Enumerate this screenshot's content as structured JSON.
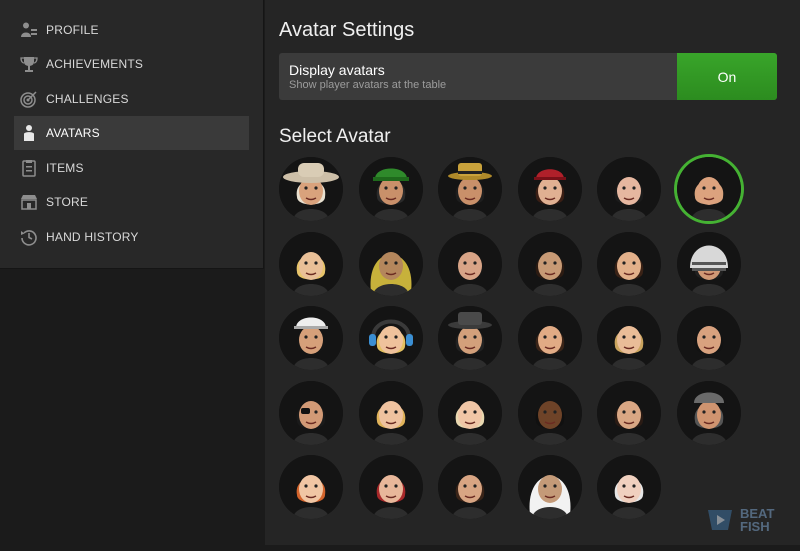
{
  "sidebar": {
    "items": [
      {
        "label": "PROFILE",
        "icon": "profile-icon",
        "active": false
      },
      {
        "label": "ACHIEVEMENTS",
        "icon": "trophy-icon",
        "active": false
      },
      {
        "label": "CHALLENGES",
        "icon": "target-icon",
        "active": false
      },
      {
        "label": "AVATARS",
        "icon": "person-icon",
        "active": true
      },
      {
        "label": "ITEMS",
        "icon": "clipboard-icon",
        "active": false
      },
      {
        "label": "STORE",
        "icon": "store-icon",
        "active": false
      },
      {
        "label": "HAND HISTORY",
        "icon": "history-icon",
        "active": false
      }
    ]
  },
  "main": {
    "title": "Avatar Settings",
    "display_avatars": {
      "label": "Display avatars",
      "description": "Show player avatars at the table",
      "button_label": "On",
      "state": "on",
      "color": "#2f9624"
    },
    "select_title": "Select Avatar",
    "selected_index": 5,
    "selected_color": "#45b233",
    "avatars": [
      {
        "skin": "#d9a27c",
        "hair": "#e8e0d0",
        "hat": "cowboy"
      },
      {
        "skin": "#c9906a",
        "hair": "#2a2a2a",
        "hat": "cap-green"
      },
      {
        "skin": "#c9906a",
        "hair": "#1e1e1e",
        "hat": "fedora-gold"
      },
      {
        "skin": "#e0b092",
        "hair": "#3a1e14",
        "hat": "cap-red"
      },
      {
        "skin": "#e6b7a0",
        "hair": "#1b1b1b",
        "hat": "none"
      },
      {
        "skin": "#dca27e",
        "hair": "#d9a27c",
        "hat": "none"
      },
      {
        "skin": "#e9bf97",
        "hair": "#e7c46a",
        "hat": "none"
      },
      {
        "skin": "#b4865c",
        "hair": "#c7b13b",
        "hat": "hood"
      },
      {
        "skin": "#d8a487",
        "hair": "#151515",
        "hat": "none"
      },
      {
        "skin": "#c79a75",
        "hair": "#2c1b12",
        "hat": "none"
      },
      {
        "skin": "#e2b08a",
        "hair": "#3a2216",
        "hat": "none"
      },
      {
        "skin": "#d09875",
        "hair": "#202020",
        "hat": "helmet"
      },
      {
        "skin": "#d6a07a",
        "hair": "#151515",
        "hat": "cap-white"
      },
      {
        "skin": "#efc29c",
        "hair": "#e3c060",
        "hat": "headphones"
      },
      {
        "skin": "#d3a07b",
        "hair": "#222222",
        "hat": "fedora-grey"
      },
      {
        "skin": "#e1ab85",
        "hair": "#3a2418",
        "hat": "none"
      },
      {
        "skin": "#eabd98",
        "hair": "#caa45e",
        "hat": "none"
      },
      {
        "skin": "#d8a27f",
        "hair": "#121212",
        "hat": "none"
      },
      {
        "skin": "#d29a76",
        "hair": "#1a1a1a",
        "hat": "eyepatch"
      },
      {
        "skin": "#efc29f",
        "hair": "#e0b35a",
        "hat": "none"
      },
      {
        "skin": "#f0c6a6",
        "hair": "#e8d8b0",
        "hat": "none"
      },
      {
        "skin": "#6e4328",
        "hair": "#101010",
        "hat": "none"
      },
      {
        "skin": "#d9a784",
        "hair": "#2a1b14",
        "hat": "none"
      },
      {
        "skin": "#cf9470",
        "hair": "#555555",
        "hat": "cap-grey"
      },
      {
        "skin": "#f1c6a4",
        "hair": "#d4642c",
        "hat": "none"
      },
      {
        "skin": "#e8b79a",
        "hair": "#a8282a",
        "hat": "none"
      },
      {
        "skin": "#d8a583",
        "hair": "#3a2418",
        "hat": "none"
      },
      {
        "skin": "#c49a78",
        "hair": "#f2f2f2",
        "hat": "hood-white"
      },
      {
        "skin": "#f0d0bf",
        "hair": "#e6e6e6",
        "hat": "none"
      }
    ]
  },
  "watermark": {
    "line1": "BEAT",
    "line2": "FISH"
  }
}
